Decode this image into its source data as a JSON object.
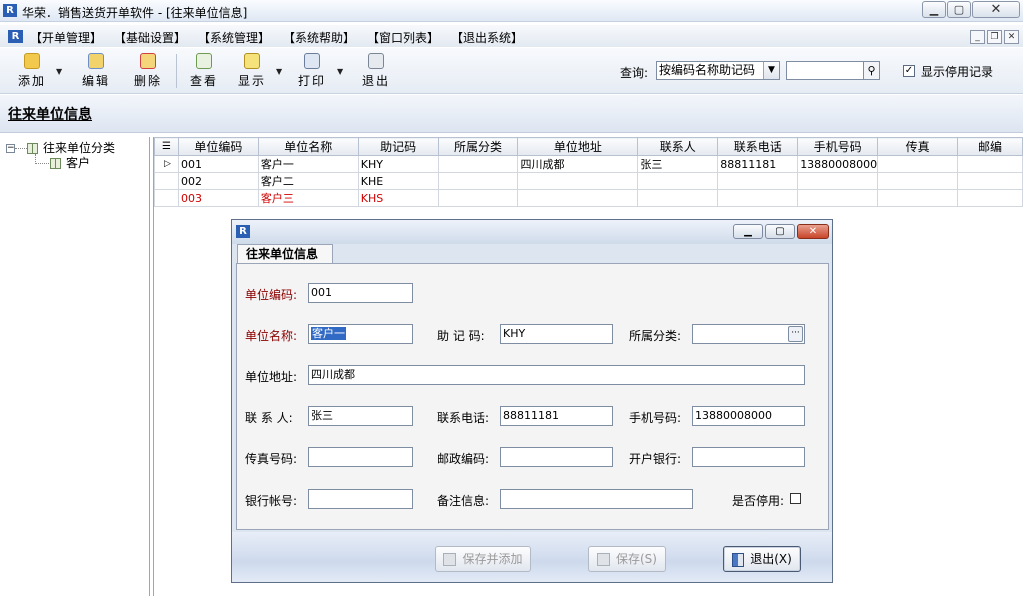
{
  "window": {
    "title": "华荣．销售送货开单软件 - [往来单位信息]",
    "logo": "R"
  },
  "menu": {
    "items": [
      "【开单管理】",
      "【基础设置】",
      "【系统管理】",
      "【系统帮助】",
      "【窗口列表】",
      "【退出系统】"
    ]
  },
  "toolbar": {
    "add": "添加",
    "edit": "编辑",
    "delete": "删除",
    "view": "查看",
    "display": "显示",
    "print": "打印",
    "exit": "退出",
    "query_label": "查询:",
    "query_mode": "按编码名称助记码",
    "query_value": "",
    "show_disabled_label": "显示停用记录",
    "show_disabled_checked": "✓"
  },
  "header": {
    "title": "往来单位信息"
  },
  "tree": {
    "root": "往来单位分类",
    "child": "客户"
  },
  "grid": {
    "columns": [
      "单位编码",
      "单位名称",
      "助记码",
      "所属分类",
      "单位地址",
      "联系人",
      "联系电话",
      "手机号码",
      "传真",
      "邮编"
    ],
    "rows": [
      [
        "001",
        "客户一",
        "KHY",
        "",
        "四川成都",
        "张三",
        "88811181",
        "13880008000",
        "",
        ""
      ],
      [
        "002",
        "客户二",
        "KHE",
        "",
        "",
        "",
        "",
        "",
        "",
        ""
      ],
      [
        "003",
        "客户三",
        "KHS",
        "",
        "",
        "",
        "",
        "",
        "",
        ""
      ]
    ],
    "current_marker": "▷"
  },
  "dialog": {
    "tab": "往来单位信息",
    "labels": {
      "code": "单位编码:",
      "name": "单位名称:",
      "mnemonic": "助 记 码:",
      "category": "所属分类:",
      "address": "单位地址:",
      "contact": "联 系 人:",
      "phone": "联系电话:",
      "mobile": "手机号码:",
      "fax": "传真号码:",
      "postcode": "邮政编码:",
      "bank": "开户银行:",
      "account": "银行帐号:",
      "remark": "备注信息:",
      "disabled": "是否停用:"
    },
    "values": {
      "code": "001",
      "name": "客户一",
      "mnemonic": "KHY",
      "category": "",
      "address": "四川成都",
      "contact": "张三",
      "phone": "88811181",
      "mobile": "13880008000",
      "fax": "",
      "postcode": "",
      "bank": "",
      "account": "",
      "remark": ""
    },
    "buttons": {
      "save_add": "保存并添加",
      "save": "保存(S)",
      "exit": "退出(X)"
    }
  }
}
